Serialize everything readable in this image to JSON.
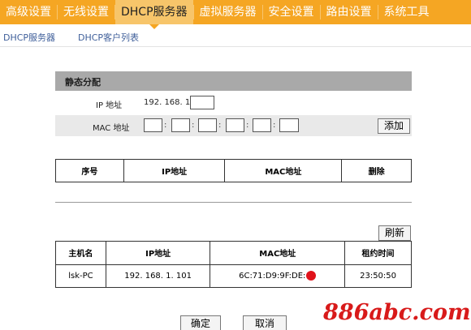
{
  "topnav": {
    "items": [
      "高级设置",
      "无线设置",
      "DHCP服务器",
      "虚拟服务器",
      "安全设置",
      "路由设置",
      "系统工具"
    ],
    "active_index": 2
  },
  "subnav": {
    "items": [
      "DHCP服务器",
      "DHCP客户列表"
    ]
  },
  "static": {
    "title": "静态分配",
    "ip_label": "IP 地址",
    "ip_prefix": "192. 168. 1.",
    "ip_last_value": "",
    "mac_label": "MAC 地址",
    "mac_values": [
      "",
      "",
      "",
      "",
      "",
      ""
    ],
    "add_label": "添加"
  },
  "static_table": {
    "headers": [
      "序号",
      "IP地址",
      "MAC地址",
      "删除"
    ]
  },
  "clients": {
    "refresh_label": "刷新",
    "headers": [
      "主机名",
      "IP地址",
      "MAC地址",
      "租约时间"
    ],
    "rows": [
      {
        "host": "lsk-PC",
        "ip": "192. 168. 1. 101",
        "mac": "6C:71:D9:9F:DE:",
        "lease": "23:50:50"
      }
    ]
  },
  "actions": {
    "ok_label": "确定",
    "cancel_label": "取消"
  },
  "watermark": "886abc.com",
  "colors": {
    "nav_bg": "#f5a623",
    "nav_active_bg": "#f7c56a",
    "panel_head": "#a9a9a9",
    "mac_mask": "#e0121a",
    "watermark": "#d81a1a"
  }
}
